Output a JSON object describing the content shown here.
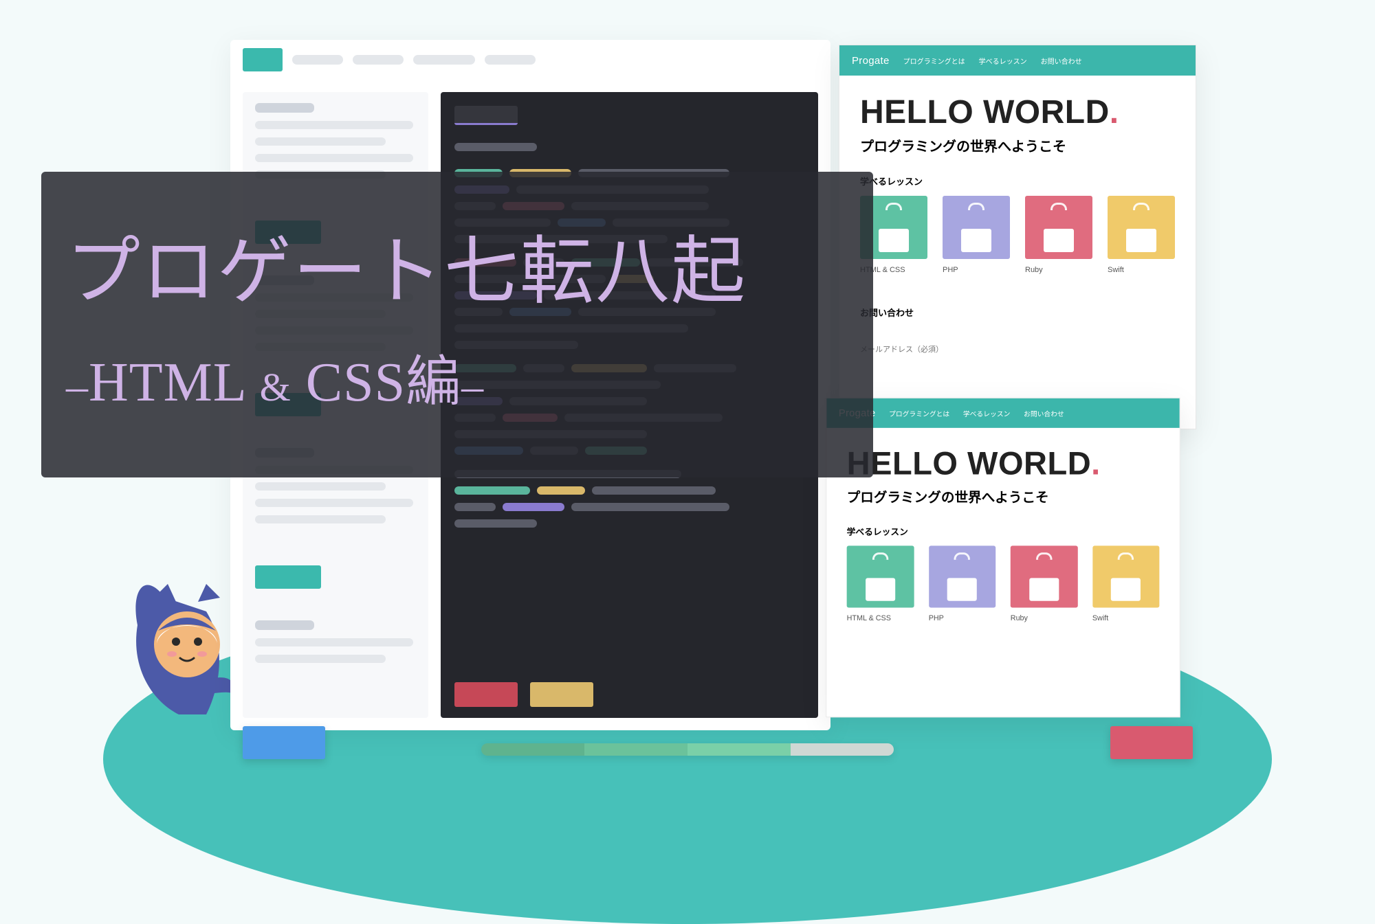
{
  "overlay": {
    "line1": "プロゲート七転八起",
    "dash": "–",
    "label": "HTML",
    "amp": "&",
    "label2": "CSS編"
  },
  "preview": {
    "navLogo": "Progate",
    "navItems": [
      "プログラミングとは",
      "学べるレッスン",
      "お問い合わせ"
    ],
    "title": "HELLO WORLD",
    "dot": ".",
    "subtitle": "プログラミングの世界へようこそ",
    "sectionLabel": "学べるレッスン",
    "cards": [
      {
        "name": "HTML & CSS"
      },
      {
        "name": "PHP"
      },
      {
        "name": "Ruby"
      },
      {
        "name": "Swift"
      }
    ],
    "contactHeading": "お問い合わせ",
    "contactField": "メールアドレス（必須）"
  }
}
